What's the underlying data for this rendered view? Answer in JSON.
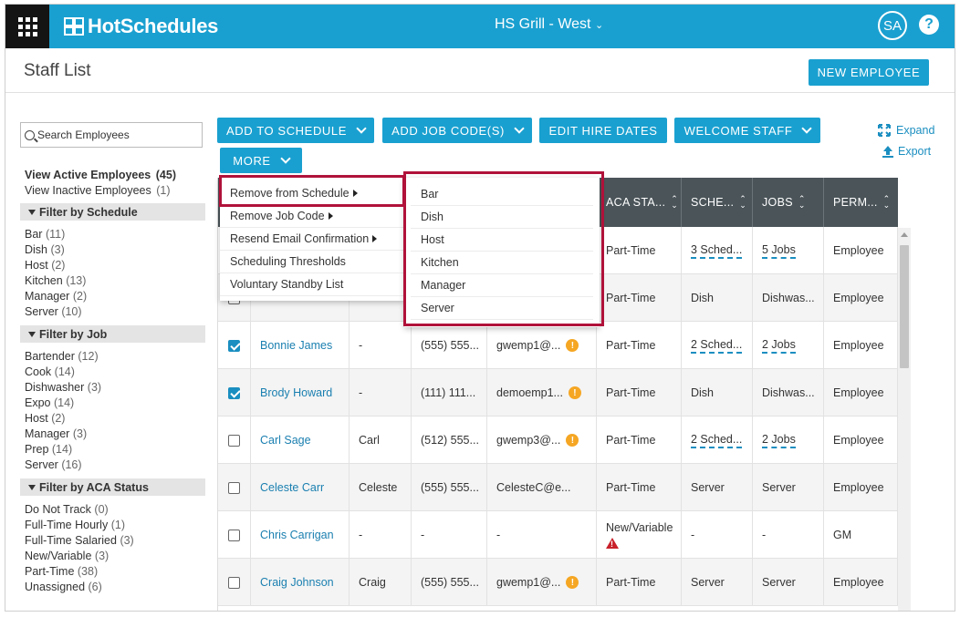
{
  "header": {
    "brand": "HotSchedules",
    "location": "HS Grill - West",
    "avatar_initials": "SA",
    "help": "?"
  },
  "page": {
    "title": "Staff List",
    "new_employee_label": "NEW EMPLOYEE"
  },
  "toolbar": {
    "add_to_schedule": "ADD TO SCHEDULE",
    "add_job_codes": "ADD JOB CODE(S)",
    "edit_hire_dates": "EDIT HIRE DATES",
    "welcome_staff": "WELCOME STAFF",
    "more": "MORE",
    "expand": "Expand",
    "export": "Export"
  },
  "sidebar": {
    "search_placeholder": "Search Employees",
    "active_label": "View Active Employees",
    "active_count": "(45)",
    "inactive_label": "View Inactive Employees",
    "inactive_count": "(1)",
    "schedule_heading": "Filter by Schedule",
    "schedule_items": [
      {
        "label": "Bar",
        "count": "(11)"
      },
      {
        "label": "Dish",
        "count": "(3)"
      },
      {
        "label": "Host",
        "count": "(2)"
      },
      {
        "label": "Kitchen",
        "count": "(13)"
      },
      {
        "label": "Manager",
        "count": "(2)"
      },
      {
        "label": "Server",
        "count": "(10)"
      }
    ],
    "job_heading": "Filter by Job",
    "job_items": [
      {
        "label": "Bartender",
        "count": "(12)"
      },
      {
        "label": "Cook",
        "count": "(14)"
      },
      {
        "label": "Dishwasher",
        "count": "(3)"
      },
      {
        "label": "Expo",
        "count": "(14)"
      },
      {
        "label": "Host",
        "count": "(2)"
      },
      {
        "label": "Manager",
        "count": "(3)"
      },
      {
        "label": "Prep",
        "count": "(14)"
      },
      {
        "label": "Server",
        "count": "(16)"
      }
    ],
    "aca_heading": "Filter by ACA Status",
    "aca_items": [
      {
        "label": "Do Not Track",
        "count": "(0)"
      },
      {
        "label": "Full-Time Hourly",
        "count": "(1)"
      },
      {
        "label": "Full-Time Salaried",
        "count": "(3)"
      },
      {
        "label": "New/Variable",
        "count": "(3)"
      },
      {
        "label": "Part-Time",
        "count": "(38)"
      },
      {
        "label": "Unassigned",
        "count": "(6)"
      }
    ]
  },
  "table": {
    "headers": {
      "aca": "ACA STA...",
      "schedules": "SCHE...",
      "jobs": "JOBS",
      "perm": "PERM..."
    },
    "rows": [
      {
        "checked": false,
        "name": "",
        "nick": "",
        "phone": "",
        "email": "",
        "warn": false,
        "aca": "Part-Time",
        "aca_alert": false,
        "schedule": "3 Sched...",
        "schedule_link": true,
        "job": "5 Jobs",
        "job_link": true,
        "perm": "Employee"
      },
      {
        "checked": false,
        "name": "",
        "nick": "",
        "phone": "",
        "email": "",
        "warn": false,
        "aca": "Part-Time",
        "aca_alert": false,
        "schedule": "Dish",
        "schedule_link": false,
        "job": "Dishwas...",
        "job_link": false,
        "perm": "Employee"
      },
      {
        "checked": true,
        "name": "Bonnie James",
        "nick": "-",
        "phone": "(555) 555...",
        "email": "gwemp1@...",
        "warn": true,
        "aca": "Part-Time",
        "aca_alert": false,
        "schedule": "2 Sched...",
        "schedule_link": true,
        "job": "2 Jobs",
        "job_link": true,
        "perm": "Employee"
      },
      {
        "checked": true,
        "name": "Brody Howard",
        "nick": "-",
        "phone": "(111) 111...",
        "email": "demoemp1...",
        "warn": true,
        "aca": "Part-Time",
        "aca_alert": false,
        "schedule": "Dish",
        "schedule_link": false,
        "job": "Dishwas...",
        "job_link": false,
        "perm": "Employee"
      },
      {
        "checked": false,
        "name": "Carl Sage",
        "nick": "Carl",
        "phone": "(512) 555...",
        "email": "gwemp3@...",
        "warn": true,
        "aca": "Part-Time",
        "aca_alert": false,
        "schedule": "2 Sched...",
        "schedule_link": true,
        "job": "2 Jobs",
        "job_link": true,
        "perm": "Employee"
      },
      {
        "checked": false,
        "name": "Celeste Carr",
        "nick": "Celeste",
        "phone": "(555) 555...",
        "email": "CelesteC@e...",
        "warn": false,
        "aca": "Part-Time",
        "aca_alert": false,
        "schedule": "Server",
        "schedule_link": false,
        "job": "Server",
        "job_link": false,
        "perm": "Employee"
      },
      {
        "checked": false,
        "name": "Chris Carrigan",
        "nick": "-",
        "phone": "-",
        "email": "-",
        "warn": false,
        "aca": "New/Variable",
        "aca_alert": true,
        "schedule": "-",
        "schedule_link": false,
        "job": "-",
        "job_link": false,
        "perm": "GM"
      },
      {
        "checked": false,
        "name": "Craig Johnson",
        "nick": "Craig",
        "phone": "(555) 555...",
        "email": "gwemp1@...",
        "warn": true,
        "aca": "Part-Time",
        "aca_alert": false,
        "schedule": "Server",
        "schedule_link": false,
        "job": "Server",
        "job_link": false,
        "perm": "Employee"
      }
    ]
  },
  "more_menu": {
    "items": [
      "Remove from Schedule",
      "Remove Job Code",
      "Resend Email Confirmation",
      "Scheduling Thresholds",
      "Voluntary Standby List"
    ]
  },
  "schedule_submenu": {
    "items": [
      "Bar",
      "Dish",
      "Host",
      "Kitchen",
      "Manager",
      "Server"
    ]
  },
  "colors": {
    "brand_blue": "#1aa0d0",
    "highlight": "#b0123a",
    "header_dark": "#4a5459"
  }
}
